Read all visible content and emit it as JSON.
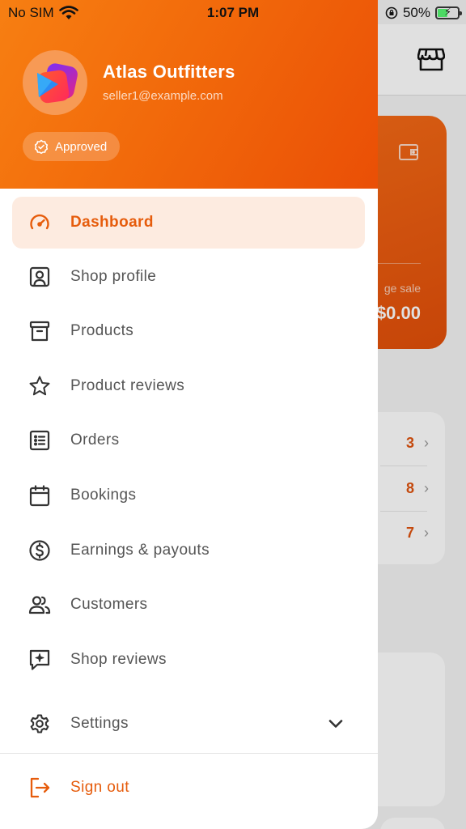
{
  "status_bar": {
    "carrier": "No SIM",
    "time": "1:07 PM",
    "battery_percent": "50%",
    "battery_level": 0.5
  },
  "drawer": {
    "shop_name": "Atlas Outfitters",
    "shop_email": "seller1@example.com",
    "status_badge": "Approved",
    "menu": [
      {
        "label": "Dashboard",
        "icon": "speedometer-icon",
        "active": true
      },
      {
        "label": "Shop profile",
        "icon": "profile-card-icon"
      },
      {
        "label": "Products",
        "icon": "archive-box-icon"
      },
      {
        "label": "Product reviews",
        "icon": "star-icon"
      },
      {
        "label": "Orders",
        "icon": "list-icon"
      },
      {
        "label": "Bookings",
        "icon": "calendar-icon"
      },
      {
        "label": "Earnings & payouts",
        "icon": "dollar-circle-icon"
      },
      {
        "label": "Customers",
        "icon": "users-icon"
      },
      {
        "label": "Shop reviews",
        "icon": "chat-sparkle-icon"
      },
      {
        "label": "Settings",
        "icon": "gear-icon"
      }
    ],
    "sign_out": "Sign out"
  },
  "background": {
    "sale_label": "ge sale",
    "sale_value": "$0.00",
    "counts": [
      "3",
      "8",
      "7"
    ]
  },
  "colors": {
    "accent": "#e65c0c",
    "header_gradient_start": "#f77f12",
    "header_gradient_end": "#ea4f06",
    "active_bg": "#fdebe0"
  }
}
